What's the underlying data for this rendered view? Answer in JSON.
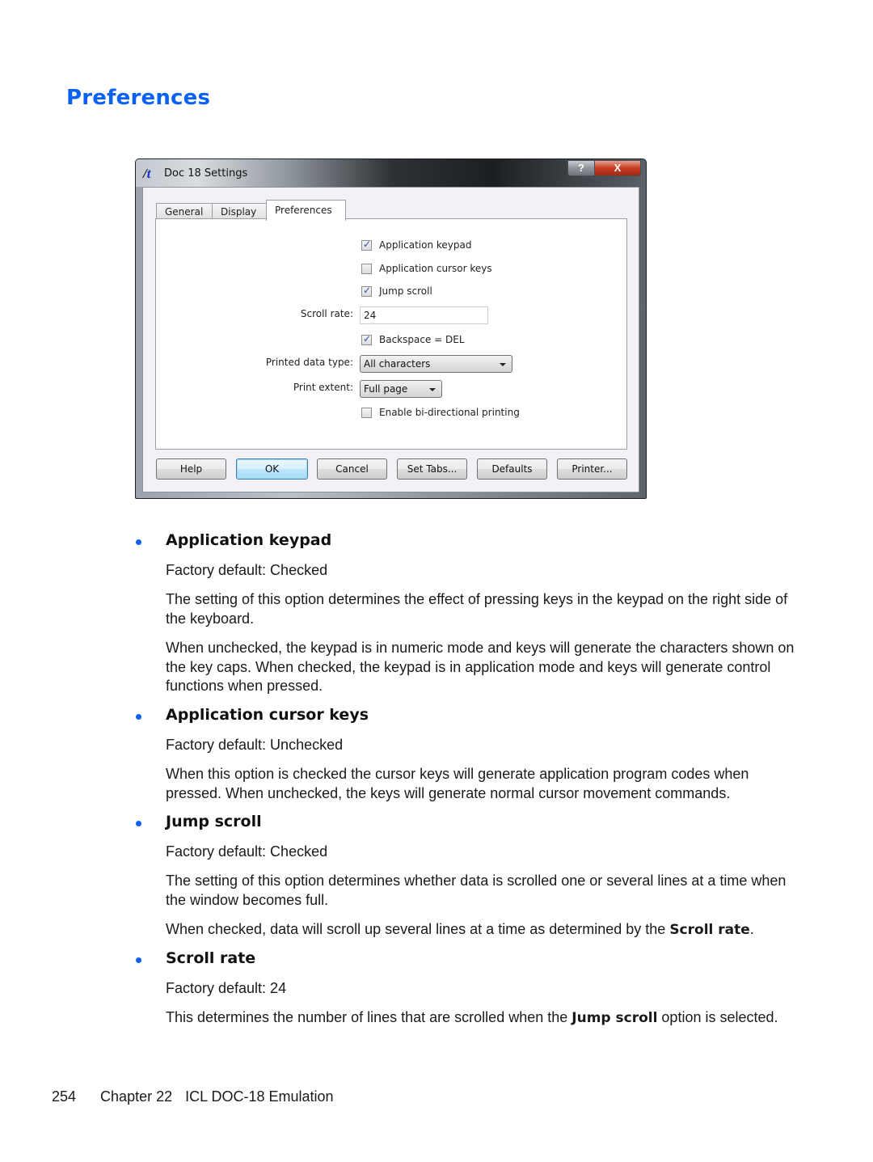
{
  "section": {
    "title": "Preferences"
  },
  "dialog": {
    "app_logo": {
      "part1": "/",
      "part2": "t"
    },
    "title": "Doc 18 Settings",
    "controls": {
      "help": "?",
      "close": "X"
    },
    "tabs": [
      {
        "label": "General",
        "active": false
      },
      {
        "label": "Display",
        "active": false
      },
      {
        "label": "Preferences",
        "active": true
      }
    ],
    "options": {
      "application_keypad": {
        "label": "Application keypad",
        "checked": true
      },
      "application_cursor_keys": {
        "label": "Application cursor keys",
        "checked": false
      },
      "jump_scroll": {
        "label": "Jump scroll",
        "checked": true
      },
      "scroll_rate": {
        "label": "Scroll rate:",
        "value": "24"
      },
      "backspace_del": {
        "label": "Backspace = DEL",
        "checked": true
      },
      "printed_data_type": {
        "label": "Printed data type:",
        "value": "All characters"
      },
      "print_extent": {
        "label": "Print extent:",
        "value": "Full page"
      },
      "bidirectional_printing": {
        "label": "Enable bi-directional printing",
        "checked": false
      }
    },
    "buttons": {
      "help": "Help",
      "ok": "OK",
      "cancel": "Cancel",
      "set_tabs": "Set Tabs...",
      "defaults": "Defaults",
      "printer": "Printer..."
    }
  },
  "items": [
    {
      "heading": "Application keypad",
      "default": "Factory default: Checked",
      "paragraphs": [
        "The setting of this option determines the effect of pressing keys in the keypad on the right side of the keyboard.",
        "When unchecked, the keypad is in numeric mode and keys will generate the characters shown on the key caps. When checked, the keypad is in application mode and keys will generate control functions when pressed."
      ]
    },
    {
      "heading": "Application cursor keys",
      "default": "Factory default: Unchecked",
      "paragraphs": [
        "When this option is checked the cursor keys will generate application program codes when pressed. When unchecked, the keys will generate normal cursor movement commands."
      ]
    },
    {
      "heading": "Jump scroll",
      "default": "Factory default: Checked",
      "paragraphs": [
        "The setting of this option determines whether data is scrolled one or several lines at a time when the window becomes full."
      ],
      "rich": {
        "before": "When checked, data will scroll up several lines at a time as determined by the ",
        "bold": "Scroll rate",
        "after": "."
      }
    },
    {
      "heading": "Scroll rate",
      "default": "Factory default: 24",
      "rich": {
        "before": "This determines the number of lines that are scrolled when the ",
        "bold": "Jump scroll",
        "after": " option is selected."
      }
    }
  ],
  "footer": {
    "page": "254",
    "chapter": "Chapter 22",
    "title": "ICL DOC-18 Emulation"
  }
}
